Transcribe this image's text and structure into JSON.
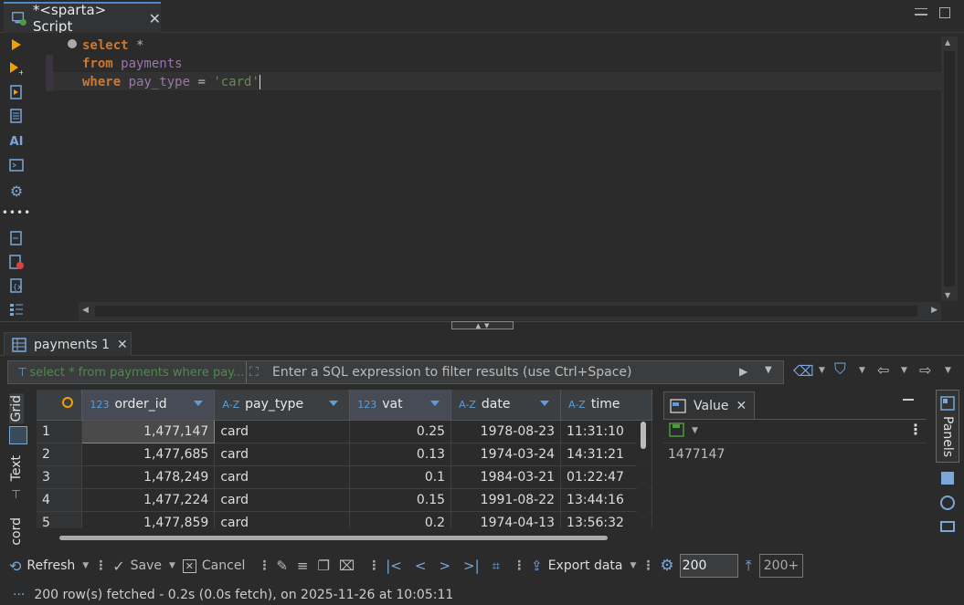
{
  "editor_tab": {
    "title": "*<sparta> Script"
  },
  "editor": {
    "lines": [
      {
        "kw": "select",
        "rest": " *"
      },
      {
        "kw": "from",
        "ident": " payments"
      },
      {
        "kw": "where",
        "ident": " pay_type",
        "op": " = ",
        "str": "'card'"
      }
    ]
  },
  "results_tab": {
    "title": "payments 1"
  },
  "filter": {
    "history": "select * from payments where pay...",
    "placeholder": "Enter a SQL expression to filter results (use Ctrl+Space)"
  },
  "side_tabs": [
    "Grid",
    "Text",
    "cord"
  ],
  "grid": {
    "columns": [
      {
        "name": "order_id",
        "type": "123"
      },
      {
        "name": "pay_type",
        "type": "A-Z"
      },
      {
        "name": "vat",
        "type": "123"
      },
      {
        "name": "date",
        "type": "A-Z"
      },
      {
        "name": "time",
        "type": "A-Z"
      }
    ],
    "rows": [
      {
        "n": "1",
        "order_id": "1,477,147",
        "pay_type": "card",
        "vat": "0.25",
        "date": "1978-08-23",
        "time": "11:31:10"
      },
      {
        "n": "2",
        "order_id": "1,477,685",
        "pay_type": "card",
        "vat": "0.13",
        "date": "1974-03-24",
        "time": "14:31:21"
      },
      {
        "n": "3",
        "order_id": "1,478,249",
        "pay_type": "card",
        "vat": "0.1",
        "date": "1984-03-21",
        "time": "01:22:47"
      },
      {
        "n": "4",
        "order_id": "1,477,224",
        "pay_type": "card",
        "vat": "0.15",
        "date": "1991-08-22",
        "time": "13:44:16"
      },
      {
        "n": "5",
        "order_id": "1,477,859",
        "pay_type": "card",
        "vat": "0.2",
        "date": "1974-04-13",
        "time": "13:56:32"
      }
    ]
  },
  "value_panel": {
    "title": "Value",
    "value": "1477147"
  },
  "panels_label": "Panels",
  "toolbar": {
    "refresh": "Refresh",
    "save": "Save",
    "cancel": "Cancel",
    "export": "Export data",
    "fetch_size": "200",
    "fetch_more": "200+"
  },
  "status": {
    "text": "200 row(s) fetched - 0.2s (0.0s fetch), on 2025-11-26 at 10:05:11",
    "dots": "···"
  },
  "colors": {
    "accent": "#4a88c7",
    "keyword": "#cc7832",
    "identifier": "#9876aa",
    "string": "#6a8759"
  }
}
